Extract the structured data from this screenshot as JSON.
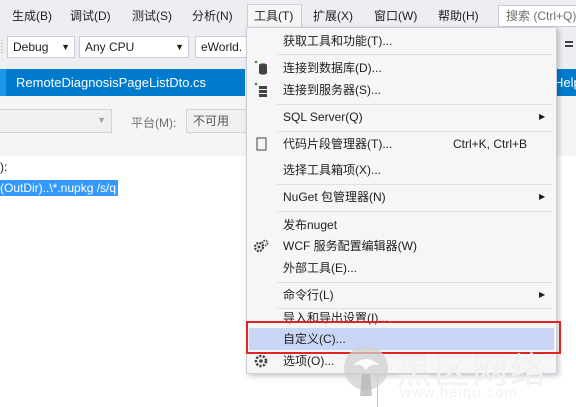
{
  "menubar": {
    "items": [
      "生成(B)",
      "调试(D)",
      "测试(S)",
      "分析(N)",
      "工具(T)",
      "扩展(X)",
      "窗口(W)",
      "帮助(H)"
    ],
    "search_placeholder": "搜索 (Ctrl+Q)"
  },
  "toolbar": {
    "configuration": "Debug",
    "platform": "Any CPU",
    "startup_project": "eWorld."
  },
  "tabs": {
    "document_tab": "RemoteDiagnosisPageListDto.cs",
    "help_tab": "Help"
  },
  "properties": {
    "platform_label": "平台(M):",
    "platform_value": "不可用",
    "event_label_fragment": "):",
    "command_text": "(OutDir)..\\*.nupkg /s/q"
  },
  "tools_menu": {
    "items": [
      {
        "label": "获取工具和功能(T)...",
        "icon": ""
      },
      {
        "label": "连接到数据库(D)...",
        "icon": "connect-database-icon"
      },
      {
        "label": "连接到服务器(S)...",
        "icon": "connect-server-icon"
      },
      {
        "label": "SQL Server(Q)",
        "icon": "",
        "submenu": "▶"
      },
      {
        "label": "代码片段管理器(T)...",
        "icon": "code-snippet-icon",
        "shortcut": "Ctrl+K, Ctrl+B"
      },
      {
        "label": "选择工具箱项(X)...",
        "icon": ""
      },
      {
        "label": "NuGet 包管理器(N)",
        "icon": "",
        "submenu": "▶"
      },
      {
        "label": "发布nuget",
        "icon": ""
      },
      {
        "label": "WCF 服务配置编辑器(W)",
        "icon": "gears-icon"
      },
      {
        "label": "外部工具(E)...",
        "icon": ""
      },
      {
        "label": "命令行(L)",
        "icon": "",
        "submenu": "▶"
      },
      {
        "label": "导入和导出设置(I)...",
        "icon": ""
      },
      {
        "label": "自定义(C)...",
        "icon": "",
        "highlighted": true
      },
      {
        "label": "选项(O)...",
        "icon": "options-gear-icon"
      }
    ]
  },
  "watermark": {
    "text": "黑区网络",
    "url": "www.heiqu.com"
  },
  "colors": {
    "accent": "#007acc",
    "selection": "#3399ff",
    "menu_highlight": "#c9d6f5",
    "callout_border": "#e02424"
  }
}
